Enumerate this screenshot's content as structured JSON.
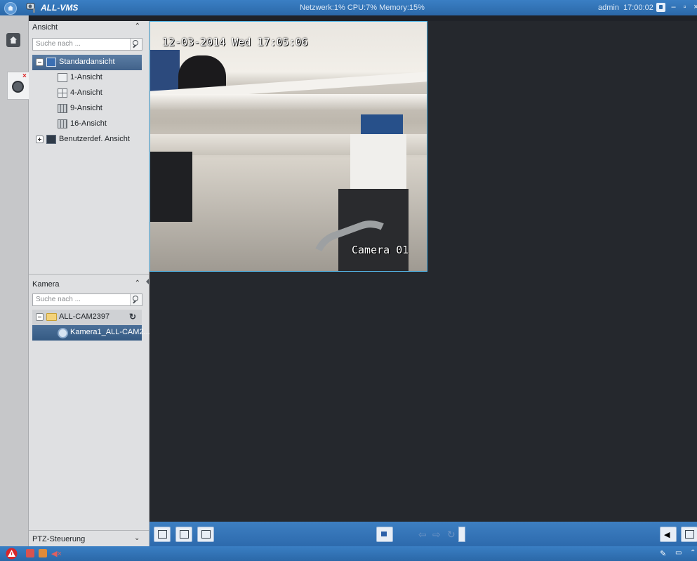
{
  "titlebar": {
    "app_name": "ALL-VMS",
    "stats": "Netzwerk:1% CPU:7% Memory:15%",
    "user": "admin",
    "clock": "17:00:02"
  },
  "ansicht": {
    "header": "Ansicht",
    "search_placeholder": "Suche nach ...",
    "items": [
      {
        "label": "Standardansicht"
      },
      {
        "label": "1-Ansicht"
      },
      {
        "label": "4-Ansicht"
      },
      {
        "label": "9-Ansicht"
      },
      {
        "label": "16-Ansicht"
      },
      {
        "label": "Benutzerdef. Ansicht"
      }
    ]
  },
  "kamera": {
    "header": "Kamera",
    "search_placeholder": "Suche nach ...",
    "device": "ALL-CAM2397",
    "camera": "Kamera1_ALL-CAM2..."
  },
  "ptz": {
    "label": "PTZ-Steuerung"
  },
  "video": {
    "timestamp": "12-03-2014 Wed 17:05:06",
    "camera_label": "Camera 01"
  },
  "colors": {
    "titlebar": "#2f6fb2",
    "panel": "#dfe0e2",
    "selection": "#4c6e96",
    "active_border": "#55b7e8"
  }
}
